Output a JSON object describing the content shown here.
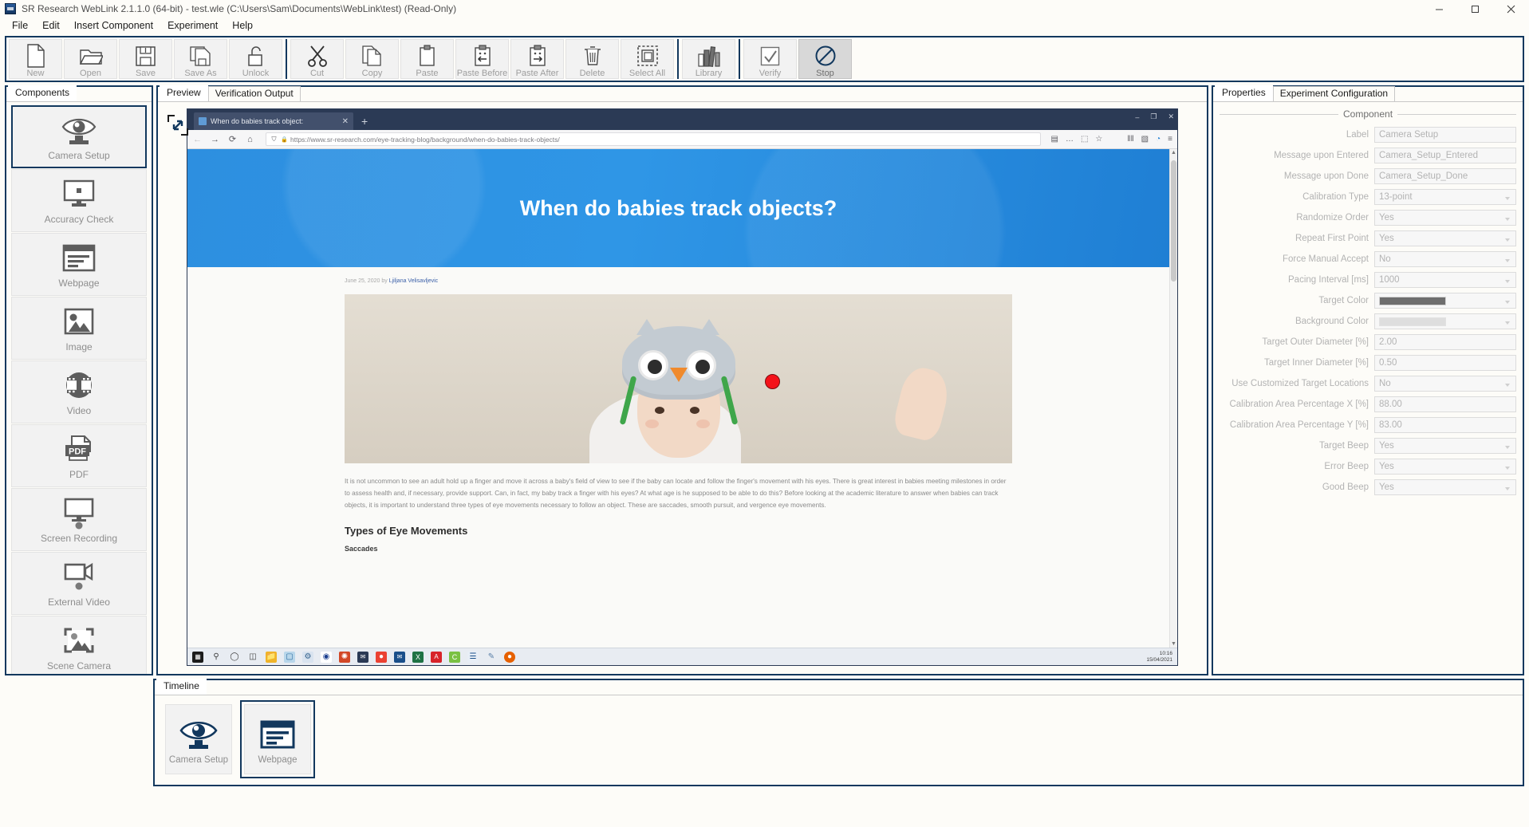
{
  "window": {
    "title": "SR Research WebLink 2.1.1.0 (64-bit) - test.wle (C:\\Users\\Sam\\Documents\\WebLink\\test) (Read-Only)",
    "minimize": "–",
    "maximize": "❐",
    "close": "✕"
  },
  "menu": [
    "File",
    "Edit",
    "Insert Component",
    "Experiment",
    "Help"
  ],
  "toolbar": {
    "groups": [
      [
        "New",
        "Open",
        "Save",
        "Save As",
        "Unlock"
      ],
      [
        "Cut",
        "Copy",
        "Paste",
        "Paste Before",
        "Paste After",
        "Delete",
        "Select All"
      ],
      [
        "Library"
      ],
      [
        "Verify",
        "Stop"
      ]
    ],
    "icons": {
      "New": "new-file-icon",
      "Open": "open-folder-icon",
      "Save": "save-floppy-icon",
      "Save As": "save-as-icon",
      "Unlock": "unlock-padlock-icon",
      "Cut": "scissors-icon",
      "Copy": "copy-pages-icon",
      "Paste": "clipboard-icon",
      "Paste Before": "paste-before-icon",
      "Paste After": "paste-after-icon",
      "Delete": "trash-icon",
      "Select All": "select-all-icon",
      "Library": "library-icon",
      "Verify": "checkmark-icon",
      "Stop": "stop-icon"
    },
    "active": "Stop"
  },
  "components": {
    "tab": "Components",
    "selected": "Camera Setup",
    "items": [
      {
        "label": "Camera Setup",
        "icon": "eye-camera-icon"
      },
      {
        "label": "Accuracy Check",
        "icon": "monitor-dot-icon"
      },
      {
        "label": "Webpage",
        "icon": "webpage-icon"
      },
      {
        "label": "Image",
        "icon": "picture-icon"
      },
      {
        "label": "Video",
        "icon": "film-reel-icon"
      },
      {
        "label": "PDF",
        "icon": "pdf-icon"
      },
      {
        "label": "Screen Recording",
        "icon": "screen-recording-icon"
      },
      {
        "label": "External Video",
        "icon": "external-video-icon"
      },
      {
        "label": "Scene Camera",
        "icon": "scene-camera-icon"
      }
    ]
  },
  "center": {
    "tabs": [
      {
        "label": "Preview",
        "active": true
      },
      {
        "label": "Verification Output",
        "active": false
      }
    ],
    "browser": {
      "tab_title": "When do babies track object:",
      "new_tab": "+",
      "window_buttons": {
        "minimize": "–",
        "maximize": "❐",
        "close": "✕"
      },
      "nav": {
        "back": "←",
        "forward": "→",
        "reload": "⟳",
        "home": "⌂",
        "shield": "⛉",
        "lock": "🔒",
        "url": "https://www.sr-research.com/eye-tracking-blog/background/when-do-babies-track-objects/",
        "reader": "▤",
        "more": "…",
        "pocket": "⬚",
        "star": "☆",
        "library": "‖‖",
        "sidebar": "▧",
        "account": "◔",
        "menu": "≡"
      },
      "page": {
        "hero_title": "When do babies track objects?",
        "byline_date": "June 25, 2020",
        "byline_by": "by",
        "byline_author": "Ljiljana Velisavljevic",
        "paragraph": "It is not uncommon to see an adult hold up a finger and move it across a baby's field of view to see if the baby can locate and follow the finger's movement with his eyes. There is great interest in babies meeting milestones in order to assess health and, if necessary, provide support. Can, in fact, my baby track a finger with his eyes? At what age is he supposed to be able to do this? Before looking at the academic literature to answer when babies can track objects, it is important to understand three types of eye movements necessary to follow an object. These are saccades, smooth pursuit, and vergence eye movements.",
        "subheading": "Types of Eye Movements",
        "subheading2": "Saccades"
      },
      "taskbar": {
        "icons": [
          "start-icon",
          "search-icon",
          "cortana-icon",
          "task-view-icon",
          "file-explorer-icon",
          "photos-icon",
          "settings-icon",
          "eye-app-icon",
          "powerpoint-icon",
          "mail-icon",
          "chrome-icon",
          "outlook-icon",
          "excel-icon",
          "acrobat-icon",
          "calc-icon",
          "notepad-icon",
          "paint-icon",
          "firefox-icon"
        ],
        "clock_time": "10:16",
        "clock_date": "15/04/2021"
      }
    }
  },
  "properties": {
    "tabs": [
      {
        "label": "Properties",
        "active": true
      },
      {
        "label": "Experiment Configuration",
        "active": false
      }
    ],
    "group_title": "Component",
    "rows": [
      {
        "label": "Label",
        "value": "Camera Setup",
        "type": "text"
      },
      {
        "label": "Message upon Entered",
        "value": "Camera_Setup_Entered",
        "type": "text"
      },
      {
        "label": "Message upon Done",
        "value": "Camera_Setup_Done",
        "type": "text"
      },
      {
        "label": "Calibration Type",
        "value": "13-point",
        "type": "combo"
      },
      {
        "label": "Randomize Order",
        "value": "Yes",
        "type": "combo"
      },
      {
        "label": "Repeat First Point",
        "value": "Yes",
        "type": "combo"
      },
      {
        "label": "Force Manual Accept",
        "value": "No",
        "type": "combo"
      },
      {
        "label": "Pacing Interval [ms]",
        "value": "1000",
        "type": "combo"
      },
      {
        "label": "Target Color",
        "value": "",
        "type": "color",
        "color": "#6e6e6e"
      },
      {
        "label": "Background Color",
        "value": "",
        "type": "color",
        "color": "#d8d8d8"
      },
      {
        "label": "Target Outer Diameter [%]",
        "value": "2.00",
        "type": "text"
      },
      {
        "label": "Target Inner Diameter [%]",
        "value": "0.50",
        "type": "text"
      },
      {
        "label": "Use Customized Target Locations",
        "value": "No",
        "type": "combo"
      },
      {
        "label": "Calibration Area Percentage X [%]",
        "value": "88.00",
        "type": "text"
      },
      {
        "label": "Calibration Area Percentage Y [%]",
        "value": "83.00",
        "type": "text"
      },
      {
        "label": "Target Beep",
        "value": "Yes",
        "type": "combo"
      },
      {
        "label": "Error Beep",
        "value": "Yes",
        "type": "combo"
      },
      {
        "label": "Good Beep",
        "value": "Yes",
        "type": "combo"
      }
    ]
  },
  "timeline": {
    "tab": "Timeline",
    "selected": "Webpage",
    "items": [
      {
        "label": "Camera Setup",
        "icon": "eye-camera-icon"
      },
      {
        "label": "Webpage",
        "icon": "webpage-icon"
      }
    ]
  },
  "colors": {
    "panel_border": "#12385e",
    "accent_blue": "#2d8fe0",
    "gaze_dot": "#f4121a",
    "window_bg": "#fdfcf8"
  }
}
